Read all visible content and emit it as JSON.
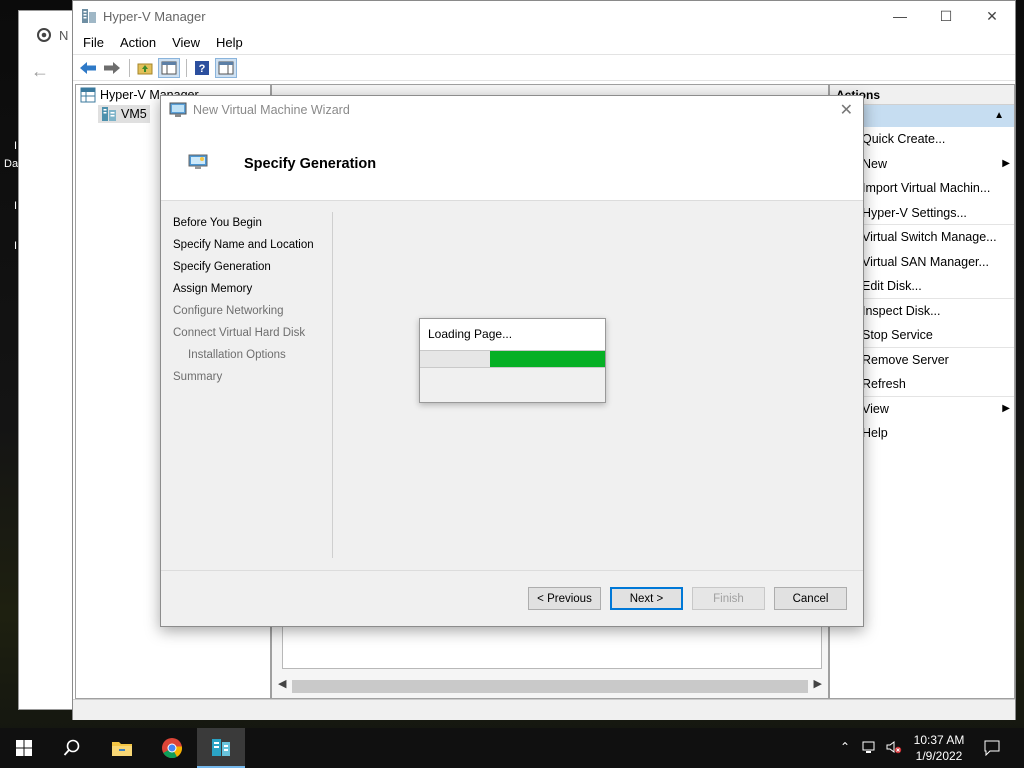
{
  "desktop": {
    "left_labels": [
      "I",
      "Da",
      "I",
      "I"
    ]
  },
  "chrome": {
    "tab_text": "N",
    "back_glyph": "←"
  },
  "hyperv": {
    "title": "Hyper-V Manager",
    "menu": [
      "File",
      "Action",
      "View",
      "Help"
    ],
    "tree": {
      "root": "Hyper-V Manager",
      "server": "VM5"
    },
    "actions": {
      "header": "Actions",
      "items": [
        {
          "label": "Quick Create...",
          "submenu": false
        },
        {
          "label": "New",
          "submenu": true
        },
        {
          "label": "Import Virtual Machin...",
          "submenu": false
        },
        {
          "label": "Hyper-V Settings...",
          "submenu": false
        },
        {
          "label": "Virtual Switch Manage...",
          "submenu": false
        },
        {
          "label": "Virtual SAN Manager...",
          "submenu": false
        },
        {
          "label": "Edit Disk...",
          "submenu": false
        },
        {
          "label": "Inspect Disk...",
          "submenu": false
        },
        {
          "label": "Stop Service",
          "submenu": false
        },
        {
          "label": "Remove Server",
          "submenu": false
        },
        {
          "label": "Refresh",
          "submenu": false
        },
        {
          "label": "View",
          "submenu": true
        },
        {
          "label": "Help",
          "submenu": false
        }
      ]
    }
  },
  "wizard": {
    "title": "New Virtual Machine Wizard",
    "heading": "Specify Generation",
    "steps": [
      {
        "label": "Before You Begin",
        "dim": false,
        "indent": false
      },
      {
        "label": "Specify Name and Location",
        "dim": false,
        "indent": false
      },
      {
        "label": "Specify Generation",
        "dim": false,
        "indent": false
      },
      {
        "label": "Assign Memory",
        "dim": false,
        "indent": false
      },
      {
        "label": "Configure Networking",
        "dim": true,
        "indent": false
      },
      {
        "label": "Connect Virtual Hard Disk",
        "dim": true,
        "indent": false
      },
      {
        "label": "Installation Options",
        "dim": true,
        "indent": true
      },
      {
        "label": "Summary",
        "dim": true,
        "indent": false
      }
    ],
    "buttons": {
      "previous": "< Previous",
      "next": "Next >",
      "finish": "Finish",
      "cancel": "Cancel"
    },
    "loading": {
      "text": "Loading Page...",
      "progress_start": 0.38,
      "progress_end": 1.0,
      "color": "#06b025"
    }
  },
  "taskbar": {
    "time": "10:37 AM",
    "date": "1/9/2022"
  },
  "colors": {
    "accent": "#0078d7",
    "actions_selected": "#c6ddf1",
    "progress": "#06b025"
  }
}
